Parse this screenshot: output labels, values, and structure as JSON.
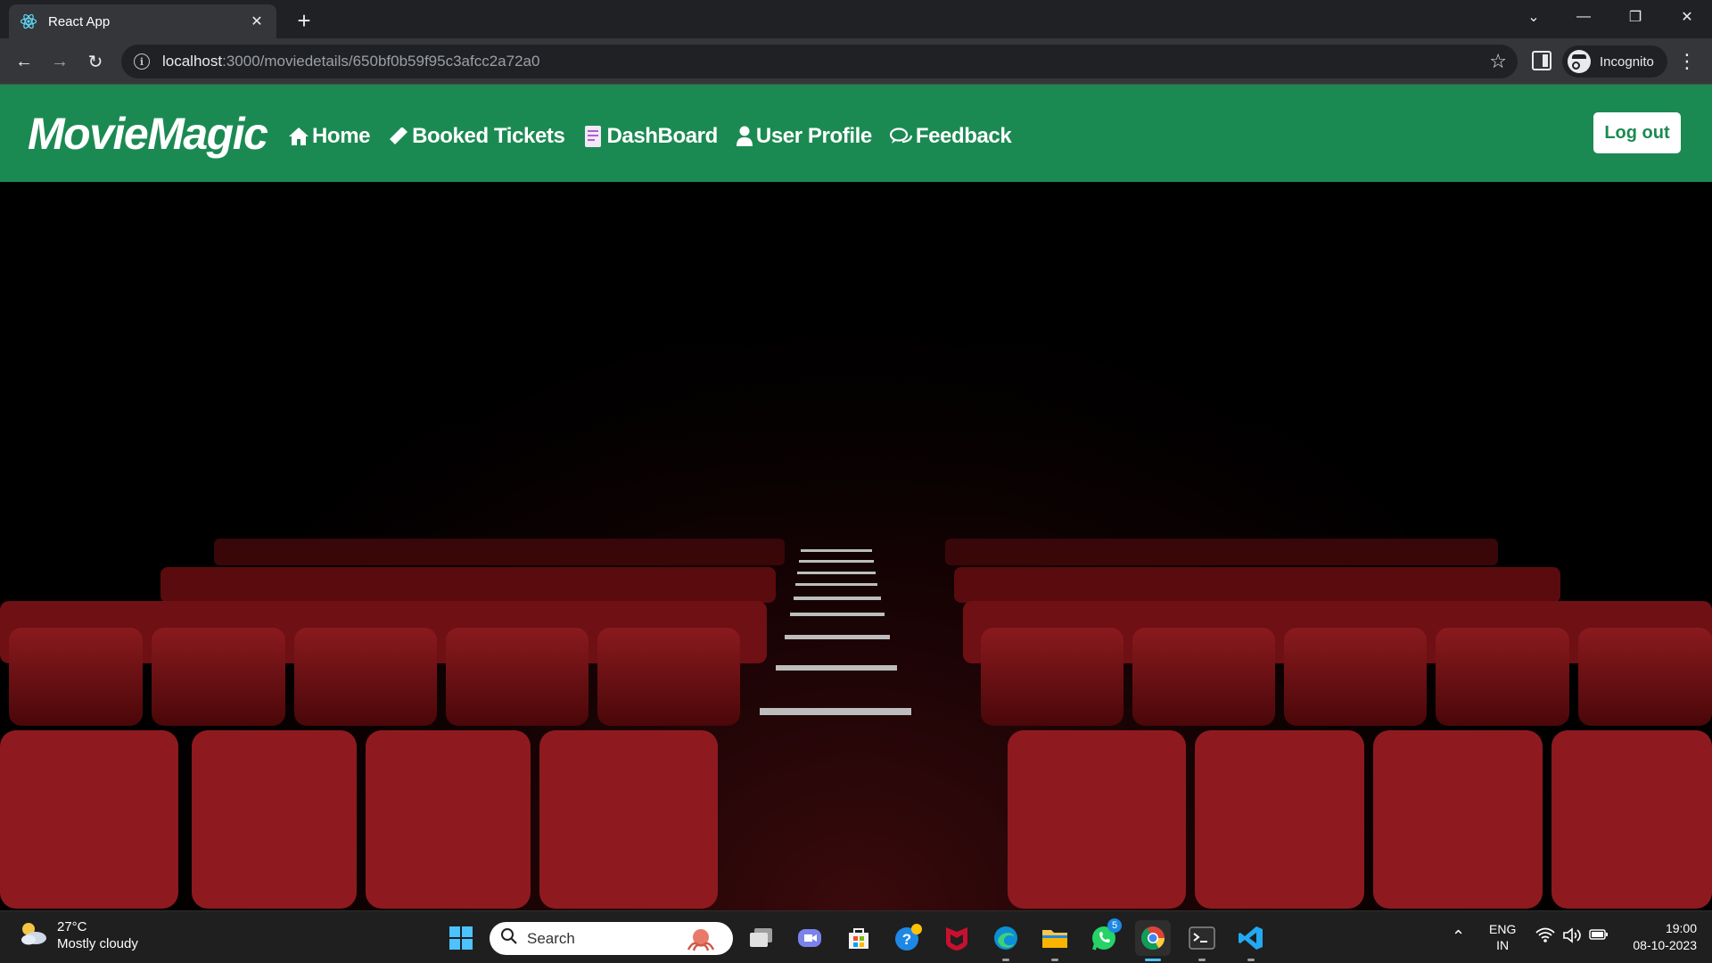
{
  "browser": {
    "tab_title": "React App",
    "url_host": "localhost",
    "url_path": ":3000/moviedetails/650bf0b59f95c3afcc2a72a0",
    "incognito_label": "Incognito"
  },
  "app": {
    "brand": "MovieMagic",
    "nav": [
      {
        "label": "Home",
        "icon": "home-icon"
      },
      {
        "label": "Booked Tickets",
        "icon": "ticket-icon"
      },
      {
        "label": "DashBoard",
        "icon": "document-icon"
      },
      {
        "label": "User Profile",
        "icon": "user-icon"
      },
      {
        "label": "Feedback",
        "icon": "chat-icon"
      }
    ],
    "logout_label": "Log out",
    "accent_color": "#1b8a52"
  },
  "taskbar": {
    "weather_temp": "27°C",
    "weather_desc": "Mostly cloudy",
    "search_placeholder": "Search",
    "whatsapp_badge": "5",
    "lang_top": "ENG",
    "lang_bottom": "IN",
    "time": "19:00",
    "date": "08-10-2023"
  }
}
